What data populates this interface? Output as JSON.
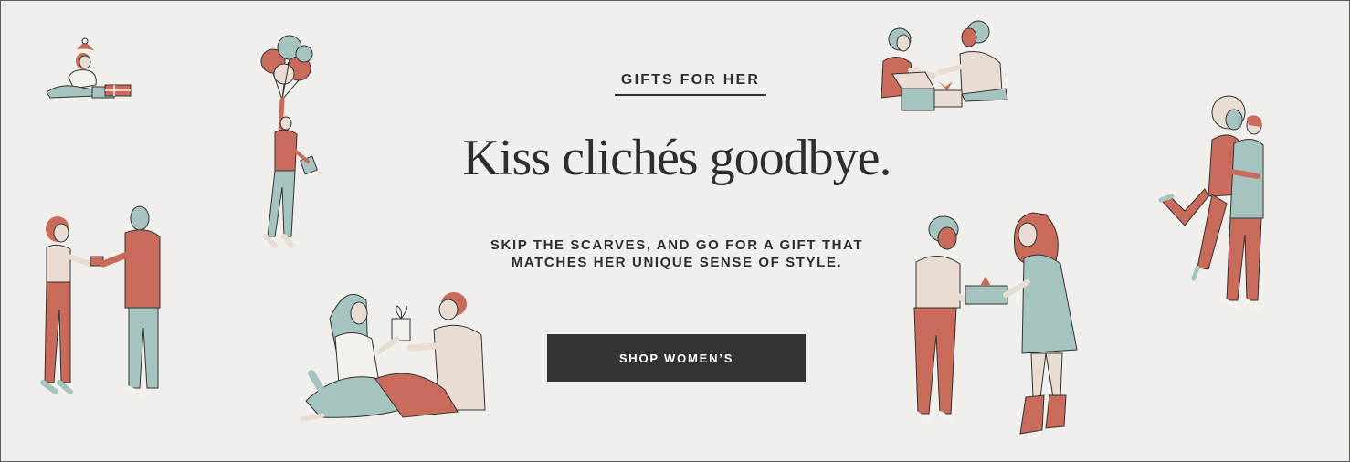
{
  "banner": {
    "eyebrow": "GIFTS FOR HER",
    "headline": "Kiss clichés goodbye.",
    "subcopy_line1": "SKIP THE SCARVES, AND GO FOR A GIFT THAT",
    "subcopy_line2": "MATCHES HER UNIQUE SENSE OF STYLE.",
    "cta_label": "SHOP WOMEN’S"
  },
  "colors": {
    "background": "#f1efec",
    "text": "#2e2e2b",
    "button": "#33342f",
    "accent_red": "#c86b5a",
    "accent_mint": "#a6c4bf"
  },
  "illustrations": [
    "santa-hat-girl-wrapping-gift",
    "woman-floating-with-balloons",
    "couple-exchanging-ring-box",
    "couple-sitting-with-gift",
    "women-unwrapping-gift-box",
    "women-exchanging-gift",
    "couple-hugging"
  ]
}
